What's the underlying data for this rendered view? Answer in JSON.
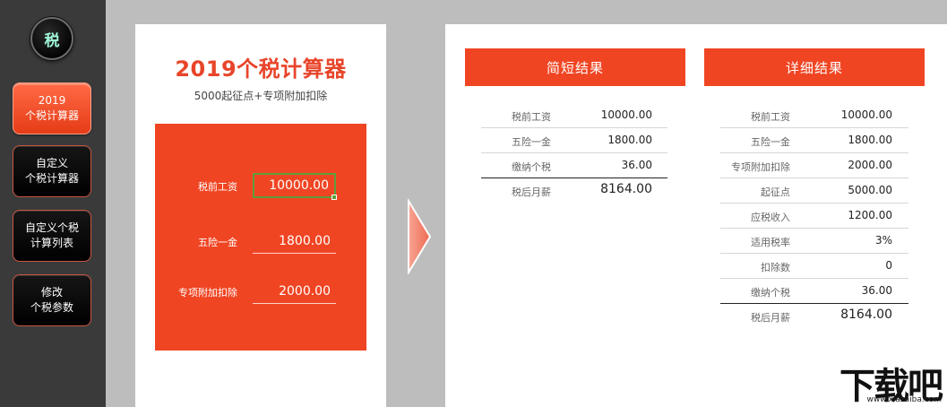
{
  "sidebar": {
    "logo_char": "税",
    "items": [
      {
        "label": "2019\n个税计算器",
        "active": true
      },
      {
        "label": "自定义\n个税计算器",
        "active": false
      },
      {
        "label": "自定义个税\n计算列表",
        "active": false
      },
      {
        "label": "修改\n个税参数",
        "active": false
      }
    ]
  },
  "calculator": {
    "title": "2019个税计算器",
    "subtitle": "5000起征点+专项附加扣除",
    "fields": [
      {
        "label": "税前工资",
        "value": "10000.00"
      },
      {
        "label": "五险一金",
        "value": "1800.00"
      },
      {
        "label": "专项附加扣除",
        "value": "2000.00"
      }
    ]
  },
  "brief": {
    "header": "简短结果",
    "rows": [
      {
        "label": "税前工资",
        "value": "10000.00"
      },
      {
        "label": "五险一金",
        "value": "1800.00"
      },
      {
        "label": "缴纳个税",
        "value": "36.00"
      },
      {
        "label": "税后月薪",
        "value": "8164.00"
      }
    ]
  },
  "detail": {
    "header": "详细结果",
    "rows": [
      {
        "label": "税前工资",
        "value": "10000.00"
      },
      {
        "label": "五险一金",
        "value": "1800.00"
      },
      {
        "label": "专项附加扣除",
        "value": "2000.00"
      },
      {
        "label": "起征点",
        "value": "5000.00"
      },
      {
        "label": "应税收入",
        "value": "1200.00"
      },
      {
        "label": "适用税率",
        "value": "3%"
      },
      {
        "label": "扣除数",
        "value": "0"
      },
      {
        "label": "缴纳个税",
        "value": "36.00"
      },
      {
        "label": "税后月薪",
        "value": "8164.00"
      }
    ]
  },
  "watermark": {
    "text": "下载吧",
    "url": "www.xiazaiba.com"
  },
  "colors": {
    "accent": "#f04523",
    "selection": "#5e9e3a",
    "sidebar": "#3a3a3a"
  }
}
